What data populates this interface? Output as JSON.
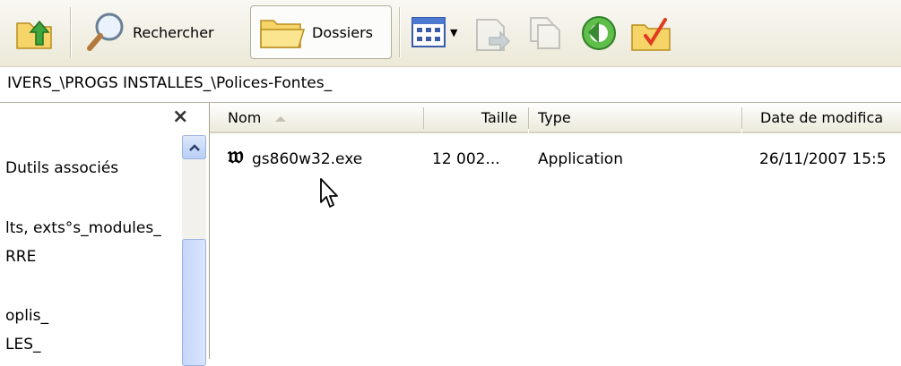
{
  "toolbar": {
    "up_icon": "folder-up-icon",
    "search_label": "Rechercher",
    "folders_label": "Dossiers"
  },
  "address": {
    "path": "IVERS_\\PROGS INSTALLES_\\Polices-Fontes_"
  },
  "left_pane": {
    "close_glyph": "×",
    "items": [
      "Dutils associés",
      "lts, exts°s_modules_",
      "RRE",
      "oplis_",
      "LES_"
    ]
  },
  "list": {
    "columns": [
      "Nom",
      "Taille",
      "Type",
      "Date de modifica"
    ],
    "rows": [
      {
        "name": "gs860w32.exe",
        "size": "12 002...",
        "type": "Application",
        "date": "26/11/2007 15:5"
      }
    ]
  },
  "colors": {
    "toolbar_bg": "#ece9d8",
    "scrollbar_blue": "#b8cef5",
    "file_icon": "#000000"
  }
}
